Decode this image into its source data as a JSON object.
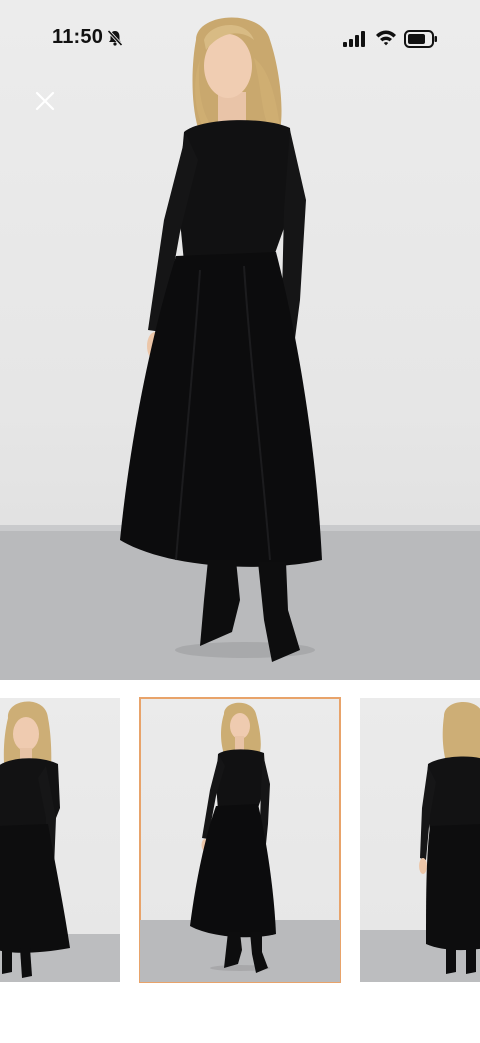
{
  "status_bar": {
    "time": "11:50",
    "icons": [
      "bell-slash-icon",
      "signal-icon",
      "wifi-icon",
      "battery-icon"
    ]
  },
  "gallery": {
    "close_icon": "close-icon",
    "selected_index": 1,
    "thumbnail_count": 3,
    "selected_border_color": "#e8a36a",
    "thumbnails": [
      {
        "view": "close-up"
      },
      {
        "view": "front"
      },
      {
        "view": "back"
      }
    ]
  }
}
